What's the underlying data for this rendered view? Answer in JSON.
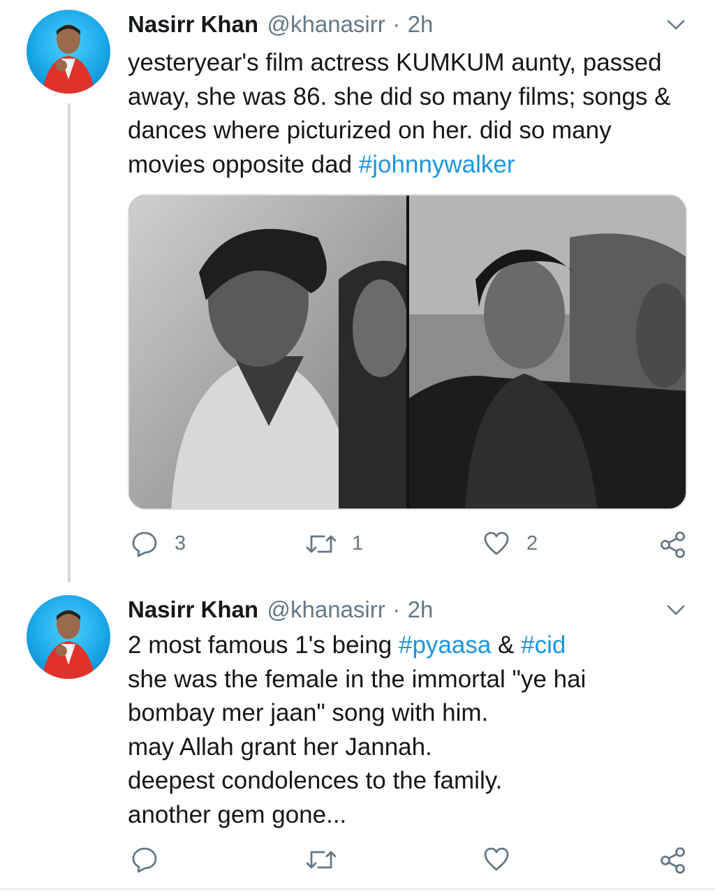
{
  "tweets": [
    {
      "author_name": "Nasirr Khan",
      "handle": "@khanasirr",
      "separator": "·",
      "time": "2h",
      "text_parts": [
        "yesteryear's film actress KUMKUM aunty, passed\naway, she was 86. she did so many films; songs &\ndances where picturized on her. did so many\nmovies opposite dad ",
        "#johnnywalker"
      ],
      "actions": {
        "reply_count": "3",
        "retweet_count": "1",
        "like_count": "2"
      }
    },
    {
      "author_name": "Nasirr Khan",
      "handle": "@khanasirr",
      "separator": "·",
      "time": "2h",
      "text_parts": [
        "2 most famous 1's being ",
        "#pyaasa",
        " & ",
        "#cid",
        "\nshe was the female in the immortal \"ye hai\nbombay mer jaan\" song with him.\nmay Allah grant her Jannah.\ndeepest condolences to the family.\nanother gem gone..."
      ],
      "actions": {
        "reply_count": "",
        "retweet_count": "",
        "like_count": ""
      }
    }
  ],
  "icons": {
    "reply": "reply-icon",
    "retweet": "retweet-icon",
    "like": "heart-icon",
    "share": "share-icon",
    "menu": "chevron-down-icon"
  },
  "colors": {
    "hashtag": "#1b95e0",
    "muted": "#657786",
    "thread_line": "#d4d9de"
  }
}
